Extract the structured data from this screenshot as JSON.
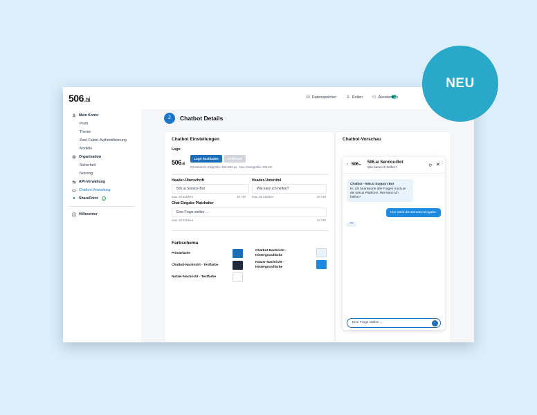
{
  "badge": "NEU",
  "brand": {
    "logo_main": "506",
    "logo_suffix": ".ai"
  },
  "topnav": [
    {
      "label": "Datenspeicher",
      "icon": "database-icon"
    },
    {
      "label": "Rollen",
      "icon": "user-icon"
    },
    {
      "label": "Assistenten",
      "icon": "robot-icon"
    }
  ],
  "sidebar": {
    "groups": [
      {
        "label": "Mein Konto",
        "icon": "user-icon",
        "items": [
          "Profil",
          "Theme",
          "Zwei-Faktor-Authentifizierung",
          "Modelle"
        ]
      },
      {
        "label": "Organisation",
        "icon": "gear-icon",
        "items": [
          "Sicherheit",
          "Nutzung"
        ]
      }
    ],
    "api": "API-Verwaltung",
    "chatbot": "Chatbot-Verwaltung",
    "sharepoint": "SharePoint",
    "help": "Hilfecenter"
  },
  "page": {
    "step": "2",
    "title": "Chatbot Details"
  },
  "settings": {
    "title": "Chatbot Einstellungen",
    "logo_label": "Logo",
    "upload_btn": "Logo hochladen",
    "remove_btn": "Entfernen",
    "logo_hint": "Erforderliche Bildgröße: 250×250 px · Max. Dateigröße: 200 KB",
    "header_title_label": "Header-Überschrift",
    "header_title_value": "506.ai Service-Bot",
    "header_title_hint": "max. 20 Zeichen",
    "header_title_count": "18 / 20",
    "header_sub_label": "Header-Untertitel",
    "header_sub_value": "Wie kann ich helfen?",
    "header_sub_hint": "max. 50 Zeichen",
    "header_sub_count": "20 / 50",
    "placeholder_label": "Chat Eingabe Platzhalter",
    "placeholder_value": "Eine Frage stellen ...",
    "placeholder_hint": "max. 50 Zeichen",
    "placeholder_count": "22 / 50"
  },
  "colors": {
    "title": "Farbschema",
    "items": [
      {
        "label": "Primärfarbe",
        "color": "#1d6eb8"
      },
      {
        "label": "Chatbot-Nachricht - Textfarbe",
        "color": "#1f2a3c"
      },
      {
        "label": "Nutzer-Nachricht - Textfarbe",
        "color": "#ffffff"
      },
      {
        "label": "Chatbot-Nachricht - Hintergrundfarbe",
        "color": "#e8f3fc"
      },
      {
        "label": "Nutzer-Nachricht - Hintergrundfarbe",
        "color": "#1d8ae0"
      }
    ]
  },
  "preview": {
    "title": "Chatbot-Vorschau",
    "bot_name": "506.ai Service-Bot",
    "bot_subtitle": "Wie kann ich helfen?",
    "bot_sender": "Chatbot - 506.ai Support Bot",
    "bot_message": "Hi, ich beantworte alle Fragen rund um die 506.ai Plattform. Wie kann ich helfen?",
    "user_message": "Hier steht die Benutzereingabe.",
    "typing": "•••",
    "input_placeholder": "Eine Frage stellen ..."
  }
}
